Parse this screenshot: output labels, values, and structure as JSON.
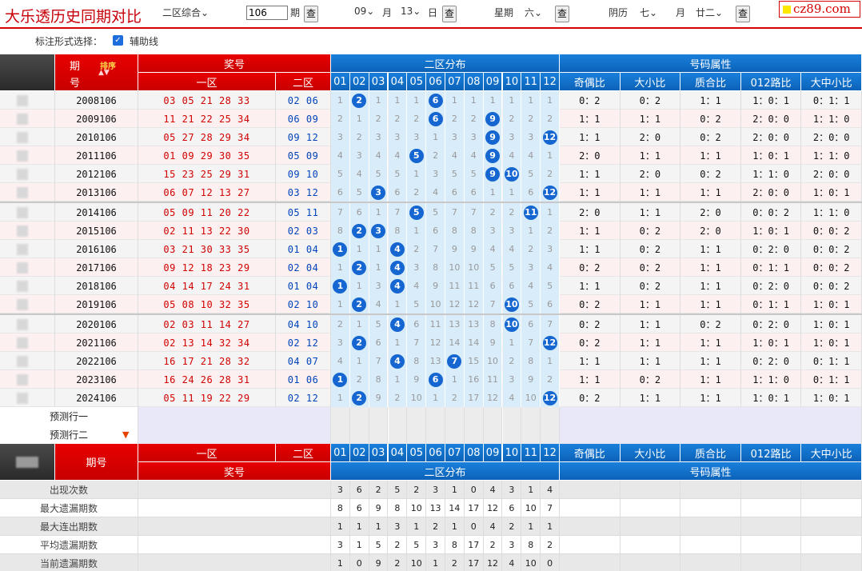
{
  "header": {
    "title": "大乐透历史同期对比",
    "zone_select": "二区综合",
    "issue_value": "106",
    "issue_label": "期",
    "query_label": "查",
    "month_value": "09",
    "month_label": "月",
    "day_value": "13",
    "day_label": "日",
    "week_label": "星期",
    "week_value": "六",
    "lunar_label": "阴历",
    "lunar_month_value": "七",
    "lunar_month_label": "月",
    "lunar_day_value": "廿二",
    "logo": "cz89.com"
  },
  "options": {
    "label": "标注形式选择：",
    "checkbox_label": "辅助线",
    "checked": true
  },
  "table": {
    "head_period": "期号",
    "head_period_top": "期",
    "head_period_bottom": "号",
    "sort_label": "排序",
    "group_prize": "奖号",
    "group_dist": "二区分布",
    "group_attr": "号码属性",
    "sub_front": "一区",
    "sub_back": "二区",
    "numbers": [
      "01",
      "02",
      "03",
      "04",
      "05",
      "06",
      "07",
      "08",
      "09",
      "10",
      "11",
      "12"
    ],
    "attr_headers": [
      "奇偶比",
      "大小比",
      "质合比",
      "012路比",
      "大中小比"
    ],
    "predict_rows": [
      "预测行一",
      "预测行二"
    ],
    "rows": [
      {
        "period": "2008106",
        "front": "03 05 21 28 33",
        "back": "02 06",
        "dist": [
          "1",
          "2",
          "1",
          "1",
          "1",
          "6",
          "1",
          "1",
          "1",
          "1",
          "1",
          "1"
        ],
        "balls": [
          2,
          6
        ],
        "attrs": [
          "0：2",
          "0：2",
          "1：1",
          "1：0：1",
          "0：1：1"
        ]
      },
      {
        "period": "2009106",
        "front": "11 21 22 25 34",
        "back": "06 09",
        "dist": [
          "2",
          "1",
          "2",
          "2",
          "2",
          "6",
          "2",
          "2",
          "9",
          "2",
          "2",
          "2"
        ],
        "balls": [
          6,
          9
        ],
        "attrs": [
          "1：1",
          "1：1",
          "0：2",
          "2：0：0",
          "1：1：0"
        ]
      },
      {
        "period": "2010106",
        "front": "05 27 28 29 34",
        "back": "09 12",
        "dist": [
          "3",
          "2",
          "3",
          "3",
          "3",
          "1",
          "3",
          "3",
          "9",
          "3",
          "3",
          "12"
        ],
        "balls": [
          9,
          12
        ],
        "attrs": [
          "1：1",
          "2：0",
          "0：2",
          "2：0：0",
          "2：0：0"
        ]
      },
      {
        "period": "2011106",
        "front": "01 09 29 30 35",
        "back": "05 09",
        "dist": [
          "4",
          "3",
          "4",
          "4",
          "5",
          "2",
          "4",
          "4",
          "9",
          "4",
          "4",
          "1"
        ],
        "balls": [
          5,
          9
        ],
        "attrs": [
          "2：0",
          "1：1",
          "1：1",
          "1：0：1",
          "1：1：0"
        ]
      },
      {
        "period": "2012106",
        "front": "15 23 25 29 31",
        "back": "09 10",
        "dist": [
          "5",
          "4",
          "5",
          "5",
          "1",
          "3",
          "5",
          "5",
          "9",
          "10",
          "5",
          "2"
        ],
        "balls": [
          9,
          10
        ],
        "attrs": [
          "1：1",
          "2：0",
          "0：2",
          "1：1：0",
          "2：0：0"
        ]
      },
      {
        "period": "2013106",
        "front": "06 07 12 13 27",
        "back": "03 12",
        "dist": [
          "6",
          "5",
          "3",
          "6",
          "2",
          "4",
          "6",
          "6",
          "1",
          "1",
          "6",
          "12"
        ],
        "balls": [
          3,
          12
        ],
        "attrs": [
          "1：1",
          "1：1",
          "1：1",
          "2：0：0",
          "1：0：1"
        ]
      },
      {
        "period": "2014106",
        "front": "05 09 11 20 22",
        "back": "05 11",
        "dist": [
          "7",
          "6",
          "1",
          "7",
          "5",
          "5",
          "7",
          "7",
          "2",
          "2",
          "11",
          "1"
        ],
        "balls": [
          5,
          11
        ],
        "attrs": [
          "2：0",
          "1：1",
          "2：0",
          "0：0：2",
          "1：1：0"
        ]
      },
      {
        "period": "2015106",
        "front": "02 11 13 22 30",
        "back": "02 03",
        "dist": [
          "8",
          "2",
          "3",
          "8",
          "1",
          "6",
          "8",
          "8",
          "3",
          "3",
          "1",
          "2"
        ],
        "balls": [
          2,
          3
        ],
        "attrs": [
          "1：1",
          "0：2",
          "2：0",
          "1：0：1",
          "0：0：2"
        ]
      },
      {
        "period": "2016106",
        "front": "03 21 30 33 35",
        "back": "01 04",
        "dist": [
          "1",
          "1",
          "1",
          "4",
          "2",
          "7",
          "9",
          "9",
          "4",
          "4",
          "2",
          "3"
        ],
        "balls": [
          1,
          4
        ],
        "attrs": [
          "1：1",
          "0：2",
          "1：1",
          "0：2：0",
          "0：0：2"
        ]
      },
      {
        "period": "2017106",
        "front": "09 12 18 23 29",
        "back": "02 04",
        "dist": [
          "1",
          "2",
          "1",
          "4",
          "3",
          "8",
          "10",
          "10",
          "5",
          "5",
          "3",
          "4"
        ],
        "balls": [
          2,
          4
        ],
        "attrs": [
          "0：2",
          "0：2",
          "1：1",
          "0：1：1",
          "0：0：2"
        ]
      },
      {
        "period": "2018106",
        "front": "04 14 17 24 31",
        "back": "01 04",
        "dist": [
          "1",
          "1",
          "3",
          "4",
          "4",
          "9",
          "11",
          "11",
          "6",
          "6",
          "4",
          "5"
        ],
        "balls": [
          1,
          4
        ],
        "attrs": [
          "1：1",
          "0：2",
          "1：1",
          "0：2：0",
          "0：0：2"
        ]
      },
      {
        "period": "2019106",
        "front": "05 08 10 32 35",
        "back": "02 10",
        "dist": [
          "1",
          "2",
          "4",
          "1",
          "5",
          "10",
          "12",
          "12",
          "7",
          "10",
          "5",
          "6"
        ],
        "balls": [
          2,
          10
        ],
        "attrs": [
          "0：2",
          "1：1",
          "1：1",
          "0：1：1",
          "1：0：1"
        ]
      },
      {
        "period": "2020106",
        "front": "02 03 11 14 27",
        "back": "04 10",
        "dist": [
          "2",
          "1",
          "5",
          "4",
          "6",
          "11",
          "13",
          "13",
          "8",
          "10",
          "6",
          "7"
        ],
        "balls": [
          4,
          10
        ],
        "attrs": [
          "0：2",
          "1：1",
          "0：2",
          "0：2：0",
          "1：0：1"
        ]
      },
      {
        "period": "2021106",
        "front": "02 13 14 32 34",
        "back": "02 12",
        "dist": [
          "3",
          "2",
          "6",
          "1",
          "7",
          "12",
          "14",
          "14",
          "9",
          "1",
          "7",
          "12"
        ],
        "balls": [
          2,
          12
        ],
        "attrs": [
          "0：2",
          "1：1",
          "1：1",
          "1：0：1",
          "1：0：1"
        ]
      },
      {
        "period": "2022106",
        "front": "16 17 21 28 32",
        "back": "04 07",
        "dist": [
          "4",
          "1",
          "7",
          "4",
          "8",
          "13",
          "7",
          "15",
          "10",
          "2",
          "8",
          "1"
        ],
        "balls": [
          4,
          7
        ],
        "attrs": [
          "1：1",
          "1：1",
          "1：1",
          "0：2：0",
          "0：1：1"
        ]
      },
      {
        "period": "2023106",
        "front": "16 24 26 28 31",
        "back": "01 06",
        "dist": [
          "1",
          "2",
          "8",
          "1",
          "9",
          "6",
          "1",
          "16",
          "11",
          "3",
          "9",
          "2"
        ],
        "balls": [
          1,
          6
        ],
        "attrs": [
          "1：1",
          "0：2",
          "1：1",
          "1：1：0",
          "0：1：1"
        ]
      },
      {
        "period": "2024106",
        "front": "05 11 19 22 29",
        "back": "02 12",
        "dist": [
          "1",
          "2",
          "9",
          "2",
          "10",
          "1",
          "2",
          "17",
          "12",
          "4",
          "10",
          "12"
        ],
        "balls": [
          2,
          12
        ],
        "attrs": [
          "0：2",
          "1：1",
          "1：1",
          "1：0：1",
          "1：0：1"
        ]
      }
    ],
    "stats": [
      {
        "label": "出现次数",
        "values": [
          "3",
          "6",
          "2",
          "5",
          "2",
          "3",
          "1",
          "0",
          "4",
          "3",
          "1",
          "4"
        ]
      },
      {
        "label": "最大遗漏期数",
        "values": [
          "8",
          "6",
          "9",
          "8",
          "10",
          "13",
          "14",
          "17",
          "12",
          "6",
          "10",
          "7"
        ]
      },
      {
        "label": "最大连出期数",
        "values": [
          "1",
          "1",
          "1",
          "3",
          "1",
          "2",
          "1",
          "0",
          "4",
          "2",
          "1",
          "1"
        ]
      },
      {
        "label": "平均遗漏期数",
        "values": [
          "3",
          "1",
          "5",
          "2",
          "5",
          "3",
          "8",
          "17",
          "2",
          "3",
          "8",
          "2"
        ]
      },
      {
        "label": "当前遗漏期数",
        "values": [
          "1",
          "0",
          "9",
          "2",
          "10",
          "1",
          "2",
          "17",
          "12",
          "4",
          "10",
          "0"
        ]
      }
    ]
  },
  "colors": {
    "red": "#d40000",
    "blue": "#1566d0",
    "dist_bg": "#d9ecfa",
    "row_alt": "#fdf0f0"
  }
}
